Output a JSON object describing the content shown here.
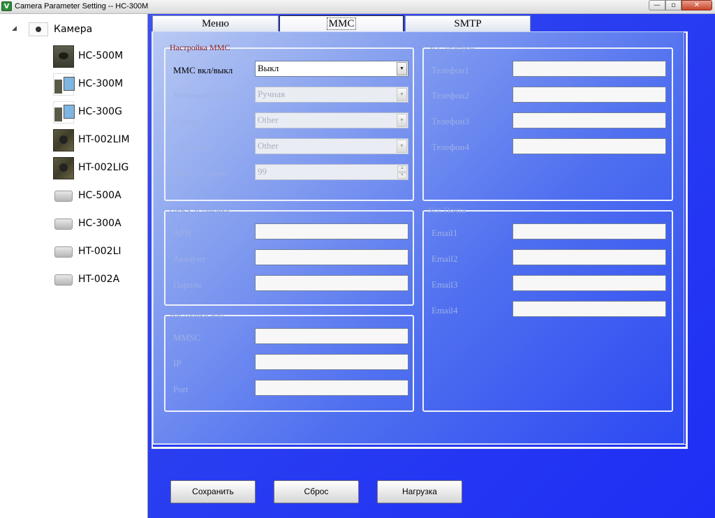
{
  "window": {
    "title": "Camera Parameter Setting -- HC-300M",
    "min_glyph": "—",
    "max_glyph": "▫",
    "close_glyph": "✕"
  },
  "tree": {
    "root_label": "Камера",
    "items": [
      {
        "label": "HC-500M",
        "icon": "camera-dark-icon"
      },
      {
        "label": "HC-300M",
        "icon": "camera-phone-icon"
      },
      {
        "label": "HC-300G",
        "icon": "camera-phone-icon"
      },
      {
        "label": "HT-002LIM",
        "icon": "camera-camo-icon"
      },
      {
        "label": "HT-002LIG",
        "icon": "camera-camo-icon"
      },
      {
        "label": "HC-500A",
        "icon": "camera-grey-icon"
      },
      {
        "label": "HC-300A",
        "icon": "camera-grey-icon"
      },
      {
        "label": "HT-002LI",
        "icon": "camera-grey-icon"
      },
      {
        "label": "HT-002A",
        "icon": "camera-grey-icon"
      }
    ]
  },
  "tabs": [
    "Меню",
    "MMC",
    "SMTP"
  ],
  "mms": {
    "legend": "Настройка MMC",
    "rows": [
      {
        "label": "MMC вкл/выкл",
        "value": "Выкл"
      },
      {
        "label": "Установка MMC",
        "value": "Ручная"
      },
      {
        "label": "Страна",
        "value": "Other"
      },
      {
        "label": "Оператор",
        "value": "Other"
      },
      {
        "label": "Фото №./день",
        "value": "99"
      }
    ]
  },
  "phone": {
    "legend": "Уст. Телефон",
    "rows": [
      {
        "label": "Телефон1",
        "value": ""
      },
      {
        "label": "Телефон2",
        "value": ""
      },
      {
        "label": "Телефон3",
        "value": ""
      },
      {
        "label": "Телефон4",
        "value": ""
      }
    ]
  },
  "gprs": {
    "legend": "GPRS Установка",
    "rows": [
      {
        "label": "APN",
        "value": ""
      },
      {
        "label": "Аккаунт",
        "value": ""
      },
      {
        "label": "Пароль",
        "value": ""
      }
    ]
  },
  "wap": {
    "legend": "Настройки wap",
    "rows": [
      {
        "label": "MMSC",
        "value": ""
      },
      {
        "label": "IP",
        "value": ""
      },
      {
        "label": "Port",
        "value": ""
      }
    ]
  },
  "email": {
    "legend": "Уст. Почта",
    "rows": [
      {
        "label": "Email1",
        "value": ""
      },
      {
        "label": "Email2",
        "value": ""
      },
      {
        "label": "Email3",
        "value": ""
      },
      {
        "label": "Email4",
        "value": ""
      }
    ]
  },
  "buttons": {
    "save": "Сохранить",
    "reset": "Сброс",
    "load": "Нагрузка"
  },
  "colors": {
    "main_bg": "#2a3ff0",
    "active_legend": "#8b1a1a",
    "disabled_text": "#9eb0e6"
  }
}
